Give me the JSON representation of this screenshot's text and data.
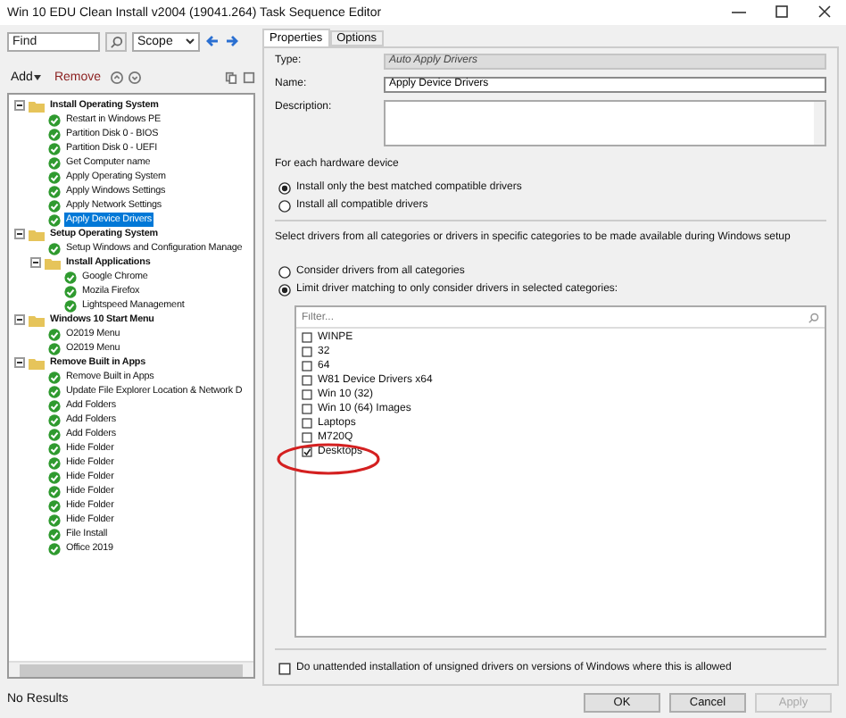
{
  "window": {
    "title": "Win 10 EDU Clean Install v2004 (19041.264) Task Sequence Editor"
  },
  "search": {
    "placeholder": "Find",
    "scope": "Scope"
  },
  "actions": [
    "Add",
    "Remove"
  ],
  "tree": [
    {
      "label": "Install Operating System",
      "kind": "group",
      "expanded": true,
      "selected": false,
      "children": [
        {
          "label": "Restart in Windows PE",
          "kind": "step",
          "selected": false
        },
        {
          "label": "Partition Disk 0 - BIOS",
          "kind": "step",
          "selected": false
        },
        {
          "label": "Partition Disk 0 - UEFI",
          "kind": "step",
          "selected": false
        },
        {
          "label": "Get Computer name",
          "kind": "step",
          "selected": false
        },
        {
          "label": "Apply Operating System",
          "kind": "step",
          "selected": false
        },
        {
          "label": "Apply Windows Settings",
          "kind": "step",
          "selected": false
        },
        {
          "label": "Apply Network Settings",
          "kind": "step",
          "selected": false
        },
        {
          "label": "Apply Device Drivers",
          "kind": "step",
          "selected": true
        }
      ]
    },
    {
      "label": "Setup Operating System",
      "kind": "group",
      "expanded": true,
      "selected": false,
      "children": [
        {
          "label": "Setup Windows and Configuration Manage",
          "kind": "step",
          "selected": false
        },
        {
          "label": "Install Applications",
          "kind": "group",
          "expanded": true,
          "selected": false,
          "children": [
            {
              "label": "Google Chrome",
              "kind": "step",
              "selected": false
            },
            {
              "label": "Mozila Firefox",
              "kind": "step",
              "selected": false
            },
            {
              "label": "Lightspeed Management",
              "kind": "step",
              "selected": false
            }
          ]
        }
      ]
    },
    {
      "label": "Windows 10 Start Menu",
      "kind": "group",
      "expanded": true,
      "selected": false,
      "children": [
        {
          "label": "O2019 Menu",
          "kind": "step",
          "selected": false
        },
        {
          "label": "O2019 Menu",
          "kind": "step",
          "selected": false
        }
      ]
    },
    {
      "label": "Remove Built in Apps",
      "kind": "group",
      "expanded": true,
      "selected": false,
      "children": [
        {
          "label": "Remove Built in Apps",
          "kind": "step",
          "selected": false
        },
        {
          "label": "Update File Explorer Location & Network D",
          "kind": "step",
          "selected": false
        },
        {
          "label": "Add Folders",
          "kind": "step",
          "selected": false
        },
        {
          "label": "Add Folders",
          "kind": "step",
          "selected": false
        },
        {
          "label": "Add Folders",
          "kind": "step",
          "selected": false
        },
        {
          "label": "Hide Folder",
          "kind": "step",
          "selected": false
        },
        {
          "label": "Hide Folder",
          "kind": "step",
          "selected": false
        },
        {
          "label": "Hide Folder",
          "kind": "step",
          "selected": false
        },
        {
          "label": "Hide Folder",
          "kind": "step",
          "selected": false
        },
        {
          "label": "Hide Folder",
          "kind": "step",
          "selected": false
        },
        {
          "label": "Hide Folder",
          "kind": "step",
          "selected": false
        },
        {
          "label": "File Install",
          "kind": "step",
          "selected": false
        },
        {
          "label": "Office 2019",
          "kind": "step",
          "selected": false
        }
      ]
    }
  ],
  "status_bar": "No Results",
  "tabs": [
    {
      "label": "Properties",
      "selected": true
    },
    {
      "label": "Options",
      "selected": false
    }
  ],
  "fields": [
    {
      "label": "Type:",
      "value": "Auto Apply Drivers",
      "disabled": true,
      "kind": "line"
    },
    {
      "label": "Name:",
      "value": "Apply Device Drivers",
      "disabled": false,
      "kind": "line"
    },
    {
      "label": "Description:",
      "kind": "area"
    }
  ],
  "hardware": {
    "heading": "For each hardware device",
    "options": [
      {
        "label": "Install only the best matched compatible drivers",
        "selected": true
      },
      {
        "label": "Install all compatible drivers",
        "selected": false
      }
    ]
  },
  "selection": {
    "heading": "Select drivers from all categories or drivers in specific categories to be made available during Windows setup",
    "options": [
      {
        "label": "Consider drivers from all categories",
        "selected": false
      },
      {
        "label": "Limit driver matching to only consider drivers in selected categories:",
        "selected": true
      }
    ]
  },
  "filter": {
    "placeholder": "Filter..."
  },
  "categories": [
    {
      "label": "WINPE",
      "checked": false
    },
    {
      "label": "32",
      "checked": false
    },
    {
      "label": "64",
      "checked": false
    },
    {
      "label": "W81 Device Drivers x64",
      "checked": false
    },
    {
      "label": "Win 10 (32)",
      "checked": false
    },
    {
      "label": "Win 10 (64) Images",
      "checked": false
    },
    {
      "label": "Laptops",
      "checked": false
    },
    {
      "label": "M720Q",
      "checked": false
    },
    {
      "label": "Desktops",
      "checked": true
    }
  ],
  "unsigned": {
    "label": "Do unattended installation of unsigned drivers on versions of Windows where this is allowed",
    "checked": false
  },
  "buttons": [
    {
      "label": "OK",
      "disabled": false
    },
    {
      "label": "Cancel",
      "disabled": false
    },
    {
      "label": "Apply",
      "disabled": true
    }
  ]
}
